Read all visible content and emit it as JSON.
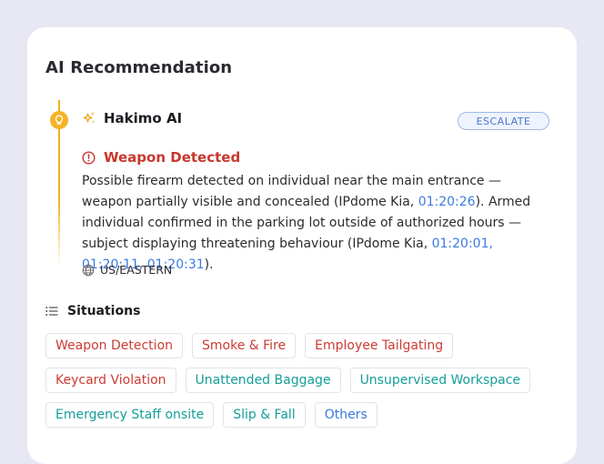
{
  "card": {
    "title": "AI Recommendation"
  },
  "recommendation": {
    "source_name": "Hakimo AI",
    "action_label": "ESCALATE",
    "alert_title": "Weapon Detected",
    "description": {
      "part1": "Possible firearm detected on individual near the main entrance — weapon partially visible and concealed (IPdome Kia, ",
      "ts1": "01:20:26",
      "part2": "). Armed individual confirmed in the parking lot outside of authorized hours — subject displaying threatening behaviour (IPdome Kia, ",
      "ts2": "01:20:01, 01:20:11, 01:20:31",
      "part3": ")."
    },
    "timezone": "US/EASTERN"
  },
  "situations": {
    "title": "Situations",
    "tags": [
      {
        "label": "Weapon Detection",
        "tone": "red"
      },
      {
        "label": "Smoke & Fire",
        "tone": "red"
      },
      {
        "label": "Employee Tailgating",
        "tone": "red"
      },
      {
        "label": "Keycard Violation",
        "tone": "red"
      },
      {
        "label": "Unattended Baggage",
        "tone": "teal"
      },
      {
        "label": "Unsupervised Workspace",
        "tone": "teal"
      },
      {
        "label": "Emergency Staff onsite",
        "tone": "teal"
      },
      {
        "label": "Slip & Fall",
        "tone": "teal"
      },
      {
        "label": "Others",
        "tone": "blue"
      }
    ]
  },
  "icons": {
    "timeline_marker": "lightbulb-icon",
    "source": "sparkle-icon",
    "alert": "alert-circle-icon",
    "timezone": "globe-icon",
    "situations": "list-icon"
  },
  "colors": {
    "accent_yellow": "#f5b324",
    "alert_red": "#c8372d",
    "timestamp_blue": "#3b7be0",
    "tag_red": "#cc3b33",
    "tag_teal": "#149e97",
    "tag_blue": "#3a78d8",
    "page_background": "#e8e8f4"
  }
}
